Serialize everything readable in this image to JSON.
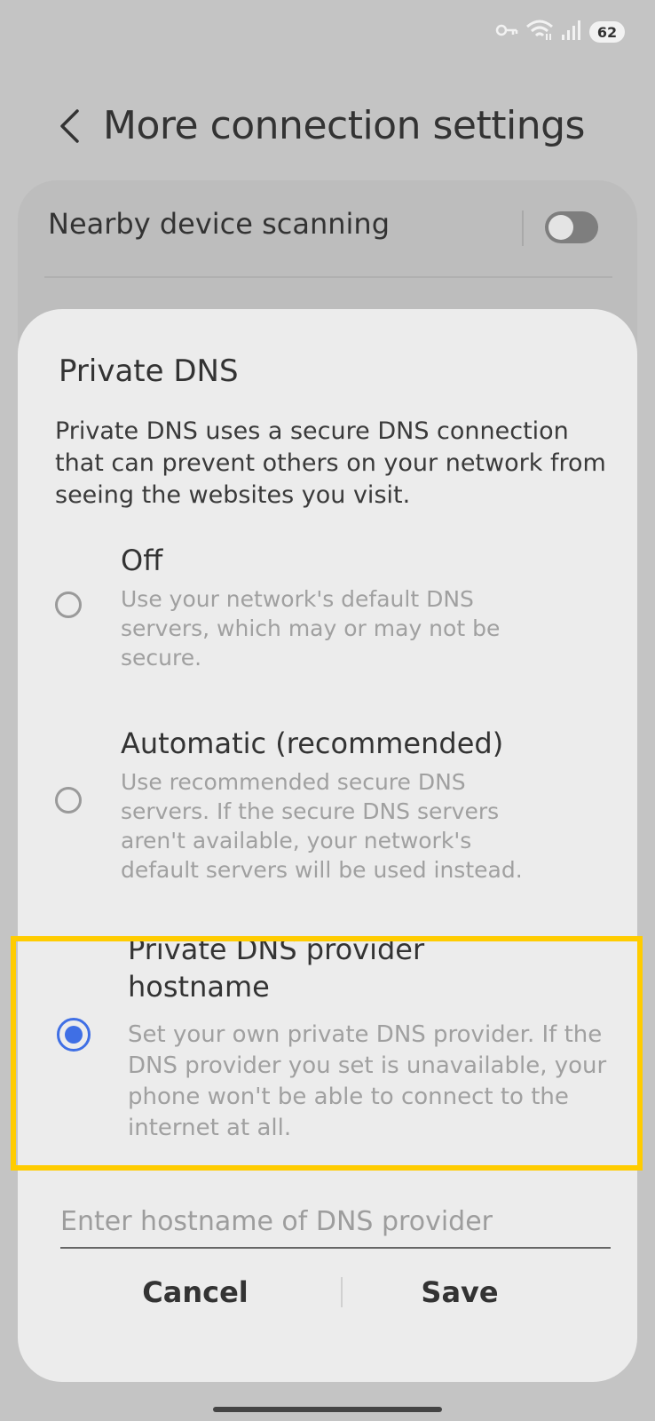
{
  "status_bar": {
    "icons": [
      "key-icon",
      "wifi-icon",
      "signal-icon"
    ],
    "battery_level": "62"
  },
  "header": {
    "title": "More connection settings",
    "back_icon": "chevron-left-icon"
  },
  "background_settings": {
    "nearby_device_scanning": {
      "label": "Nearby device scanning",
      "toggle_on": false
    }
  },
  "dialog": {
    "title": "Private DNS",
    "description": "Private DNS uses a secure DNS connection that can prevent others on your network from seeing the websites you visit.",
    "options": [
      {
        "title": "Off",
        "description": "Use your network's default DNS servers, which may or may not be secure.",
        "selected": false
      },
      {
        "title": "Automatic (recommended)",
        "description": "Use recommended secure DNS servers. If the secure DNS servers aren't available, your network's default servers will be used instead.",
        "selected": false
      },
      {
        "title": "Private DNS provider hostname",
        "description": "Set your own private DNS provider. If the DNS provider you set is unavailable, your phone won't be able to connect to the internet at all.",
        "selected": true
      }
    ],
    "hostname_input": {
      "placeholder": "Enter hostname of DNS provider",
      "value": ""
    },
    "cancel_label": "Cancel",
    "save_label": "Save"
  },
  "colors": {
    "accent": "#3f6fe5",
    "highlight": "#ffcc00",
    "dialog_bg": "#ececec",
    "scrim_bg": "#c4c4c4"
  }
}
